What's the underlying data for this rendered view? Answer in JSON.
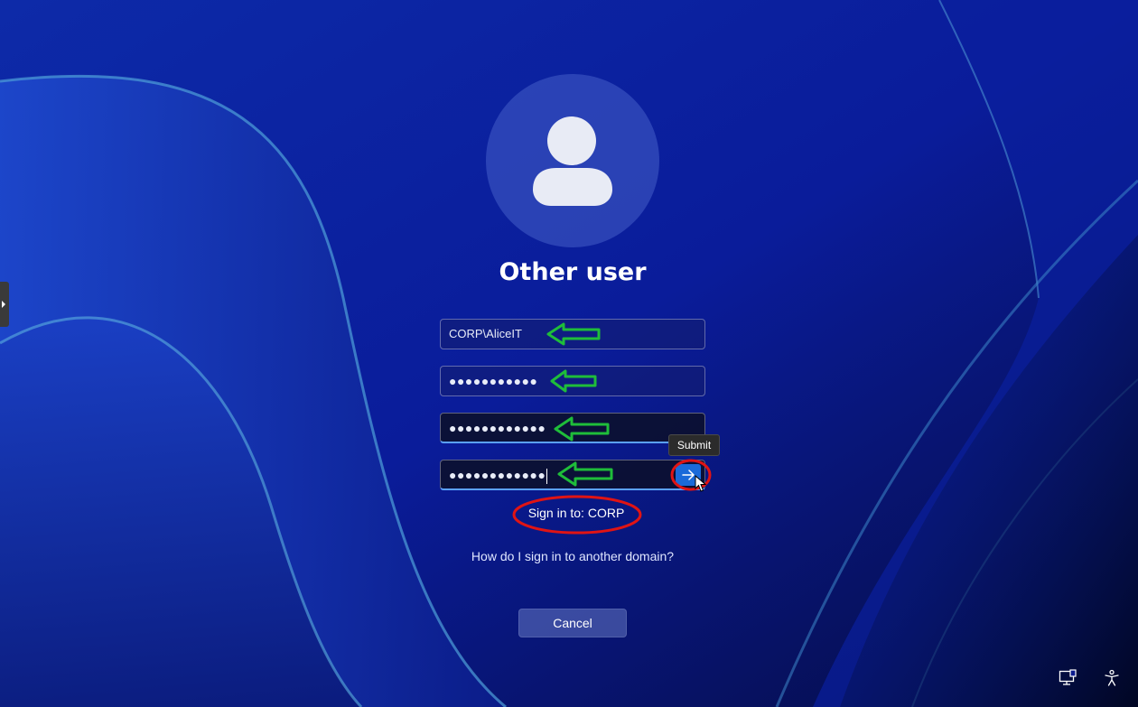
{
  "login": {
    "user_title": "Other user",
    "username_value": "CORP\\AliceIT",
    "password_mask": "●●●●●●●●●●●",
    "new_password_mask": "●●●●●●●●●●●●",
    "confirm_password_mask": "●●●●●●●●●●●●",
    "submit_tooltip": "Submit",
    "sign_in_to": "Sign in to: CORP",
    "other_domain_link": "How do I sign in to another domain?",
    "cancel_label": "Cancel"
  },
  "icons": {
    "avatar": "user-avatar-icon",
    "submit": "arrow-right-icon",
    "left_tab": "chevron-right-icon",
    "network": "network-icon",
    "accessibility": "accessibility-icon",
    "cursor": "mouse-cursor-icon"
  },
  "annotations": {
    "arrow_color": "#1fbd3a",
    "circle_color": "#e01414"
  },
  "colors": {
    "accent": "#1b6ad9",
    "background": "#0a1a8f"
  }
}
